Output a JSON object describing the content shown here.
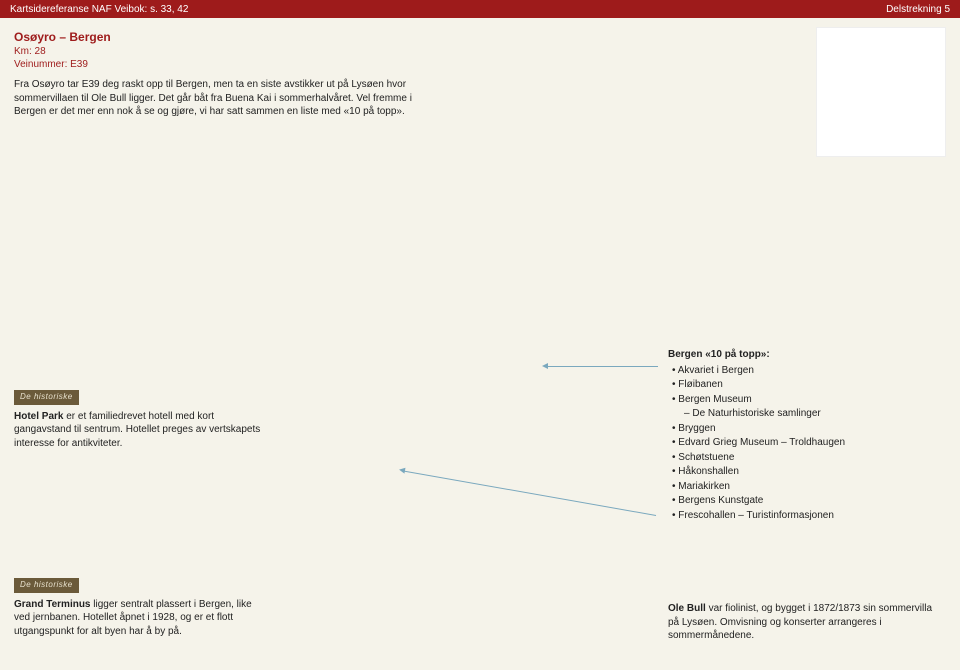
{
  "header": {
    "left": "Kartsidereferanse NAF Veibok: s. 33, 42",
    "right": "Delstrekning 5"
  },
  "route": {
    "title": "Osøyro – Bergen",
    "km_label": "Km: 28",
    "road_label": "Veinummer: E39",
    "paragraph": "Fra Osøyro tar E39 deg raskt opp til Bergen, men ta en siste avstikker ut på Lysøen hvor sommervillaen til Ole Bull ligger. Det går båt fra Buena Kai i sommerhalvåret. Vel fremme i Bergen er det mer enn nok å se og gjøre, vi har satt sammen en liste med «10 på topp»."
  },
  "logo_text": "De historiske",
  "hotel_park": {
    "bold": "Hotel Park",
    "rest": " er et familiedrevet hotell med kort gangavstand til sentrum. Hotellet preges av vertskapets interesse for antikviteter."
  },
  "bergen_list": {
    "heading": "Bergen «10 på topp»:",
    "items": [
      "Akvariet i Bergen",
      "Fløibanen",
      "Bergen Museum",
      "De Naturhistoriske samlinger",
      "Bryggen",
      "Edvard Grieg Museum – Troldhaugen",
      "Schøtstuene",
      "Håkonshallen",
      "Mariakirken",
      "Bergens Kunstgate",
      "Frescohallen – Turistinformasjonen"
    ],
    "sub_index": 3
  },
  "grand_terminus": {
    "bold": "Grand Terminus",
    "rest": " ligger sentralt plassert i Bergen, like ved jernbanen. Hotellet åpnet i 1928, og er et flott utgangspunkt for alt byen har å by på."
  },
  "ole_bull": {
    "bold": "Ole Bull",
    "rest": " var fiolinist, og bygget i 1872/1873 sin sommervilla på Lysøen. Omvisning og konserter arrangeres i sommermånedene."
  }
}
